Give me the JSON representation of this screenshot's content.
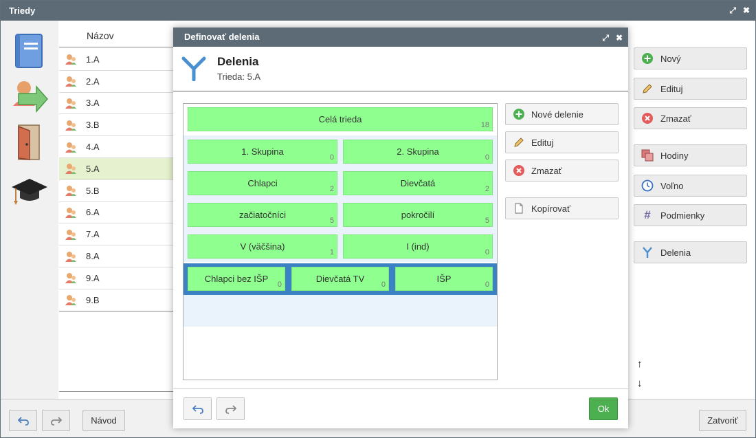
{
  "window": {
    "title": "Triedy"
  },
  "list": {
    "header": "Názov",
    "rows": [
      {
        "name": "1.A"
      },
      {
        "name": "2.A"
      },
      {
        "name": "3.A"
      },
      {
        "name": "3.B"
      },
      {
        "name": "4.A"
      },
      {
        "name": "5.A"
      },
      {
        "name": "5.B"
      },
      {
        "name": "6.A"
      },
      {
        "name": "7.A"
      },
      {
        "name": "8.A"
      },
      {
        "name": "9.A"
      },
      {
        "name": "9.B"
      }
    ],
    "selected": "5.A"
  },
  "side_buttons": {
    "new": "Nový",
    "edit": "Edituj",
    "delete": "Zmazať",
    "hours": "Hodiny",
    "free": "Voľno",
    "conditions": "Podmienky",
    "divisions": "Delenia"
  },
  "footer": {
    "help": "Návod",
    "close": "Zatvoriť"
  },
  "modal": {
    "title": "Definovať delenia",
    "heading": "Delenia",
    "subheading": "Trieda: 5.A",
    "whole": {
      "label": "Celá trieda",
      "count": "18"
    },
    "groups": [
      [
        {
          "label": "1. Skupina",
          "count": "0"
        },
        {
          "label": "2. Skupina",
          "count": "0"
        }
      ],
      [
        {
          "label": "Chlapci",
          "count": "2"
        },
        {
          "label": "Dievčatá",
          "count": "2"
        }
      ],
      [
        {
          "label": "začiatočníci",
          "count": "5"
        },
        {
          "label": "pokročilí",
          "count": "5"
        }
      ],
      [
        {
          "label": "V (väčšina)",
          "count": "1"
        },
        {
          "label": "I (ind)",
          "count": "0"
        }
      ]
    ],
    "selected_row": [
      {
        "label": "Chlapci bez IŠP",
        "count": "0"
      },
      {
        "label": "Dievčatá TV",
        "count": "0"
      },
      {
        "label": "IŠP",
        "count": "0"
      }
    ],
    "buttons": {
      "new_division": "Nové delenie",
      "edit": "Edituj",
      "delete": "Zmazať",
      "copy": "Kopírovať"
    },
    "ok": "Ok"
  },
  "colors": {
    "titlebar": "#5d6b76",
    "cell": "#8fff8f",
    "selection": "#3b82c4",
    "ok": "#4caf50"
  }
}
